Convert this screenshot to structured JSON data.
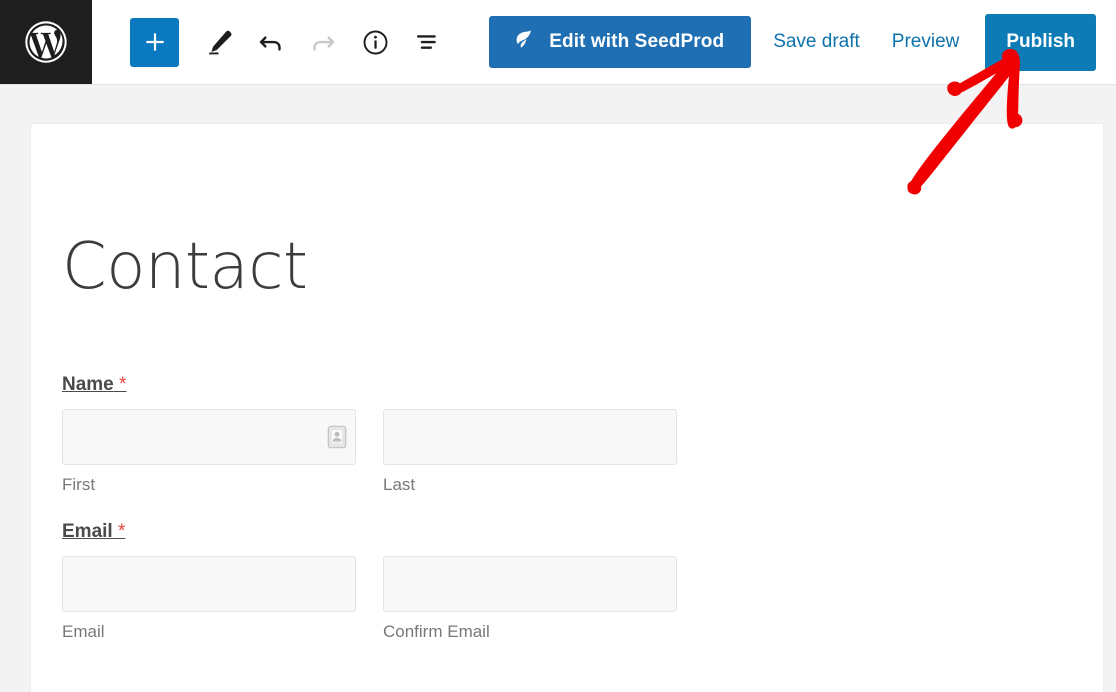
{
  "app": {
    "name": "WordPress Block Editor",
    "logo_icon": "wordpress-logo-icon"
  },
  "toolbar": {
    "add_block_label": "+",
    "add_block_icon": "plus-icon",
    "tools": [
      {
        "name": "edit-tool",
        "icon": "pencil-icon",
        "disabled": false
      },
      {
        "name": "undo",
        "icon": "undo-arrow-icon",
        "disabled": false
      },
      {
        "name": "redo",
        "icon": "redo-arrow-icon",
        "disabled": true
      },
      {
        "name": "details",
        "icon": "info-circle-icon",
        "disabled": false
      },
      {
        "name": "list-view",
        "icon": "list-view-icon",
        "disabled": false
      }
    ],
    "seedprod": {
      "label": "Edit with SeedProd",
      "icon": "seedprod-leaf-icon",
      "color": "#1f6fb2"
    },
    "save_draft_label": "Save draft",
    "preview_label": "Preview",
    "publish_label": "Publish",
    "publish_color": "#0d7bb5",
    "link_color": "#0e72ad"
  },
  "post": {
    "title": "Contact"
  },
  "form": {
    "fields": [
      {
        "label": "Name",
        "required_mark": "*",
        "columns": [
          {
            "sub_label": "First",
            "value": "",
            "icon": "contact-autofill-icon"
          },
          {
            "sub_label": "Last",
            "value": ""
          }
        ]
      },
      {
        "label": "Email",
        "required_mark": "*",
        "columns": [
          {
            "sub_label": "Email",
            "value": ""
          },
          {
            "sub_label": "Confirm Email",
            "value": ""
          }
        ]
      }
    ]
  },
  "annotation": {
    "type": "hand-drawn-arrow",
    "color": "#f00000",
    "points_to": "publish-button"
  }
}
